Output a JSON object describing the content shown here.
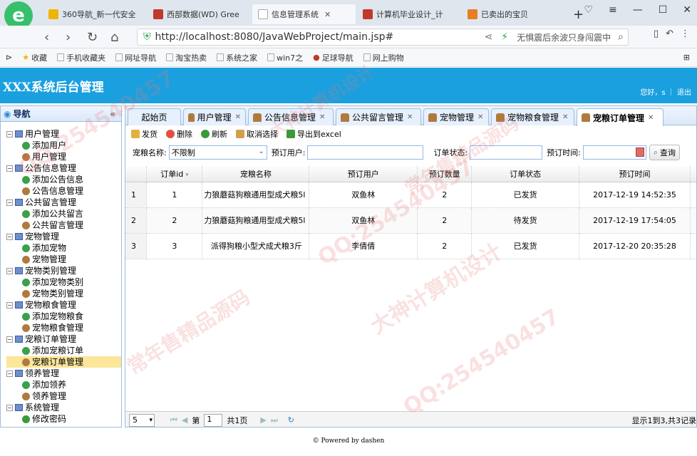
{
  "browser": {
    "tabs": [
      {
        "label": "360导航_新一代安全",
        "color": "#f0b400"
      },
      {
        "label": "西部数据(WD) Gree",
        "color": "#c0392b"
      },
      {
        "label": "信息管理系统",
        "color": "#cccccc"
      },
      {
        "label": "计算机毕业设计_计",
        "color": "#c0392b"
      },
      {
        "label": "已卖出的宝贝",
        "color": "#e67e22"
      }
    ],
    "new_tab": "+",
    "url": "http://localhost:8080/JavaWebProject/main.jsp#",
    "search_text": "无惧震后余波只身闯震中"
  },
  "bookmarks": [
    "收藏",
    "手机收藏夹",
    "网址导航",
    "淘宝热卖",
    "系统之家",
    "win7之",
    "足球导航",
    "网上购物"
  ],
  "app": {
    "title": "XXX系统后台管理",
    "user_text": "您好，s ｜ 退出",
    "nav_title": "导航",
    "nav_collapse": "«",
    "footer": "© Powered by dashen"
  },
  "nav": [
    {
      "label": "用户管理",
      "items": [
        "添加用户",
        "用户管理"
      ]
    },
    {
      "label": "公告信息管理",
      "items": [
        "添加公告信息",
        "公告信息管理"
      ]
    },
    {
      "label": "公共留言管理",
      "items": [
        "添加公共留言",
        "公共留言管理"
      ]
    },
    {
      "label": "宠物管理",
      "items": [
        "添加宠物",
        "宠物管理"
      ]
    },
    {
      "label": "宠物类别管理",
      "items": [
        "添加宠物类别",
        "宠物类别管理"
      ]
    },
    {
      "label": "宠物粮食管理",
      "items": [
        "添加宠物粮食",
        "宠物粮食管理"
      ]
    },
    {
      "label": "宠粮订单管理",
      "items": [
        "添加宠粮订单",
        "宠粮订单管理"
      ]
    },
    {
      "label": "领养管理",
      "items": [
        "添加领养",
        "领养管理"
      ]
    },
    {
      "label": "系统管理",
      "items": [
        "修改密码"
      ]
    }
  ],
  "selected_nav": "宠粮订单管理",
  "panel_tabs": [
    "起始页",
    "用户管理",
    "公告信息管理",
    "公共留言管理",
    "宠物管理",
    "宠物粮食管理",
    "宠粮订单管理"
  ],
  "toolbar": {
    "send": "发货",
    "delete": "删除",
    "refresh": "刷新",
    "cancel_select": "取消选择",
    "export": "导出到excel"
  },
  "search": {
    "food_label": "宠粮名称:",
    "food_value": "不限制",
    "user_label": "预订用户:",
    "user_value": "",
    "status_label": "订单状态:",
    "status_value": "",
    "time_label": "预订时间:",
    "time_value": "",
    "query": "查询"
  },
  "grid": {
    "columns": [
      "订单id",
      "宠粮名称",
      "预订用户",
      "预订数量",
      "订单状态",
      "预订时间"
    ],
    "rows": [
      {
        "rn": "1",
        "id": "1",
        "name": "力狼蘑菇狗粮通用型成犬粮5l",
        "user": "双鱼林",
        "qty": "2",
        "status": "已发货",
        "time": "2017-12-19 14:52:35"
      },
      {
        "rn": "2",
        "id": "2",
        "name": "力狼蘑菇狗粮通用型成犬粮5l",
        "user": "双鱼林",
        "qty": "2",
        "status": "待发货",
        "time": "2017-12-19 17:54:05"
      },
      {
        "rn": "3",
        "id": "3",
        "name": "派得狗粮小型犬成犬粮3斤",
        "user": "李倩倩",
        "qty": "2",
        "status": "已发货",
        "time": "2017-12-20 20:35:28"
      }
    ]
  },
  "pager": {
    "page_size": "5",
    "page_prefix": "第",
    "page": "1",
    "page_suffix": "共1页",
    "info": "显示1到3,共3记录"
  },
  "watermarks": [
    "QQ:254540457",
    "大神计算机设计",
    "常年售精品源码"
  ]
}
